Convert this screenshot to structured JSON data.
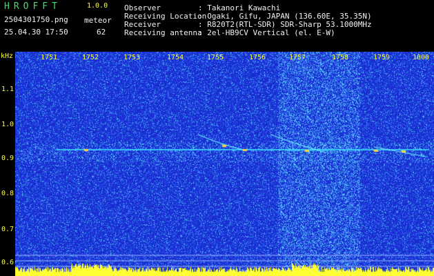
{
  "header": {
    "brand": "HROFFT",
    "version": "1.0.0",
    "filename": "2504301750.png",
    "datetime": "25.04.30 17:50",
    "meteor_label": "meteor",
    "meteor_count": "62"
  },
  "info": [
    {
      "label": "Observer",
      "value": ": Takanori Kawachi"
    },
    {
      "label": "Receiving Location",
      "value": ": Ogaki, Gifu, JAPAN (136.60E, 35.35N)"
    },
    {
      "label": "Receiver",
      "value": ": R820T2(RTL-SDR) SDR-Sharp 53.1000MHz"
    },
    {
      "label": "Receiving antenna",
      "value": ": 2el-HB9CV Vertical (el. E-W)"
    }
  ],
  "axes": {
    "unit": "kHz",
    "time_ticks": [
      "1751",
      "1752",
      "1753",
      "1754",
      "1755",
      "1756",
      "1757",
      "1758",
      "1759",
      "1800"
    ],
    "freq_ticks": [
      "1.1",
      "1.0",
      "0.9",
      "0.8",
      "0.7",
      "0.6"
    ]
  },
  "colors": {
    "background": "#1a2bd0",
    "text_green": "#3ee06a",
    "text_yellow": "#ffff33",
    "carrier": "#3ef0ff",
    "echo": "#ffd040"
  }
}
